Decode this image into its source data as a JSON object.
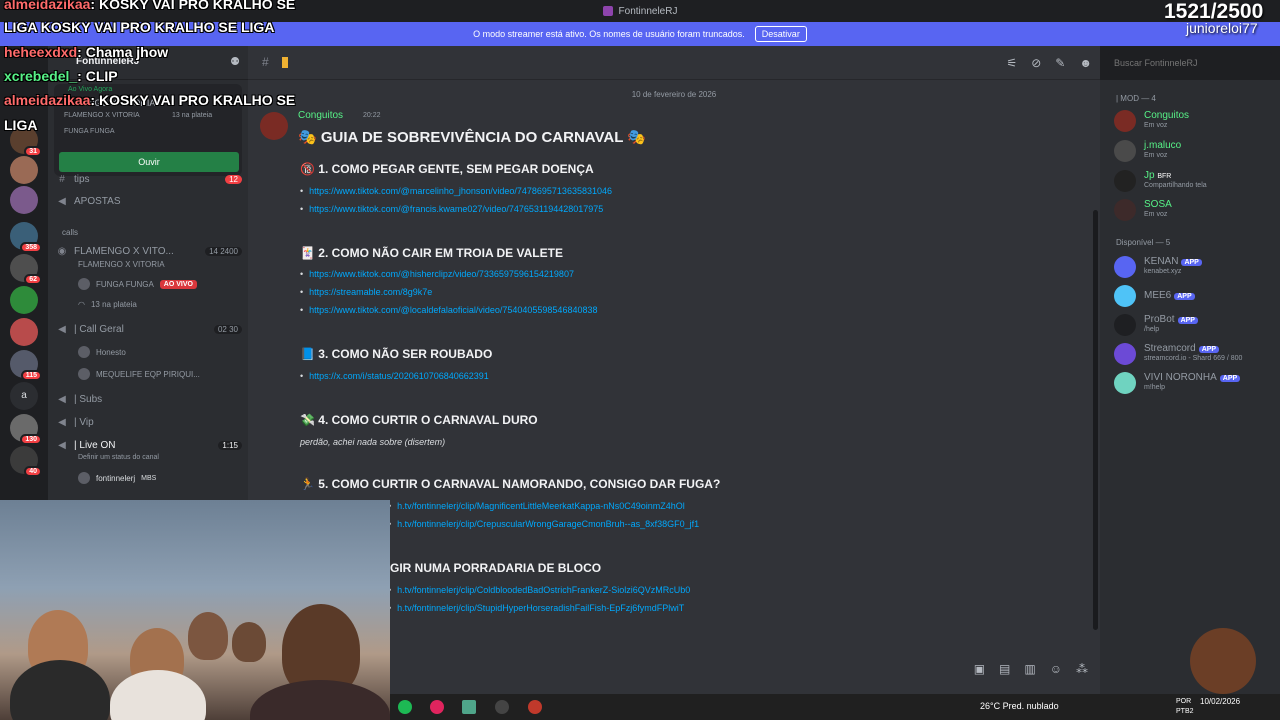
{
  "window": {
    "title": "FontinneleRJ"
  },
  "banner": {
    "text": "O modo streamer está ativo. Os nomes de usuário foram truncados.",
    "button": "Desativar"
  },
  "stream": {
    "counter": "1521/2500",
    "handle": "junioreloi77"
  },
  "chat_overlay": [
    {
      "user": "almeidazikaa",
      "text": "KOSKY VAI PRO KRALHO SE"
    },
    {
      "user": "",
      "text": "LIGA KOSKY VAI PRO KRALHO SE LIGA"
    },
    {
      "user": "heheexdxd",
      "text": "Chama jhow"
    },
    {
      "user": "xcrebedel_",
      "text": "CLIP"
    },
    {
      "user": "almeidazikaa",
      "text": "KOSKY VAI PRO KRALHO SE"
    },
    {
      "user": "",
      "text": "LIGA"
    }
  ],
  "sidebar": {
    "server_name": "FontinneleRJ",
    "event": {
      "live": "Ao Vivo Agora",
      "title": "FLAMENGO X VITORIA",
      "meta1": "FLAMENGO X VITORIA",
      "meta2": "13 na plateia",
      "host": "FUNGA FUNGA",
      "button": "Ouvir"
    },
    "channels": [
      {
        "name": "tips",
        "num": "12"
      },
      {
        "name": "APOSTAS",
        "num": ""
      },
      {
        "name": "calls",
        "num": ""
      },
      {
        "name": "FLAMENGO X VITO...",
        "num": "14  2400"
      },
      {
        "name": "FLAMENGO X VITORIA",
        "num": ""
      },
      {
        "name": "FUNGA FUNGA",
        "num": "AO VIVO"
      },
      {
        "name": "13 na plateia",
        "num": ""
      },
      {
        "name": "| Call Geral",
        "num": "02  30"
      },
      {
        "name": "Honesto",
        "num": ""
      },
      {
        "name": "MEQUELIFE EQP PIRIQUI...",
        "num": ""
      },
      {
        "name": "| Subs",
        "num": ""
      },
      {
        "name": "| Vip",
        "num": ""
      },
      {
        "name": "| Live ON",
        "num": "1:15"
      },
      {
        "name": "Definir um status do canal",
        "num": ""
      },
      {
        "name": "fontinnelerj",
        "num": "MBS"
      }
    ]
  },
  "rail_badges": [
    "31",
    "358",
    "62",
    "115",
    "130",
    "40",
    "a"
  ],
  "main": {
    "date": "10 de fevereiro de 2026",
    "author": "Conguitos",
    "time": "20:22",
    "title": "GUIA DE SOBREVIVÊNCIA DO CARNAVAL",
    "sections": [
      {
        "title": "1. COMO PEGAR GENTE, SEM PEGAR DOENÇA",
        "links": [
          "https://www.tiktok.com/@marcelinho_jhonson/video/7478695713635831046",
          "https://www.tiktok.com/@francis.kwame027/video/7476531194428017975"
        ]
      },
      {
        "title": "2. COMO NÃO CAIR EM TROIA DE VALETE",
        "links": [
          "https://www.tiktok.com/@hisherclipz/video/7336597596154219807",
          "https://streamable.com/8g9k7e",
          "https://www.tiktok.com/@localdefalaoficial/video/7540405598546840838"
        ]
      },
      {
        "title": "3. COMO NÃO SER ROUBADO",
        "links": [
          "https://x.com/i/status/2020610706840662391"
        ]
      },
      {
        "title": "4. COMO CURTIR O CARNAVAL DURO",
        "note": "perdão, achei nada sobre (disertem)"
      },
      {
        "title": "5. COMO CURTIR O CARNAVAL NAMORANDO, CONSIGO DAR FUGA?",
        "links": [
          "h.tv/fontinnelerj/clip/MagnificentLittleMeerkatKappa-nNs0C49oinmZ4hOl",
          "h.tv/fontinnelerj/clip/CrepuscularWrongGarageCmonBruh--as_8xf38GF0_jf1"
        ]
      },
      {
        "title": "GIR NUMA PORRADARIA DE BLOCO",
        "links": [
          "h.tv/fontinnelerj/clip/ColdbloodedBadOstrichFrankerZ-Siolzi6QVzMRcUb0",
          "h.tv/fontinnelerj/clip/StupidHyperHorseradishFailFish-EpFzj6fymdFPlwiT"
        ]
      }
    ]
  },
  "search": {
    "placeholder": "Buscar FontinneleRJ"
  },
  "members": {
    "group_mod": "| MOD — 4",
    "mods": [
      {
        "name": "Conguitos",
        "status": "Em voz",
        "color": "#57f287"
      },
      {
        "name": "j.maluco",
        "status": "Em voz",
        "color": "#57f287"
      },
      {
        "name": "Jp",
        "tag": "BFR",
        "status": "Compartilhando tela",
        "color": "#57f287"
      },
      {
        "name": "SOSA",
        "status": "Em voz",
        "color": "#57f287"
      }
    ],
    "group_avail": "Disponível — 5",
    "available": [
      {
        "name": "KENAN",
        "tag": "APP",
        "status": "kenabet.xyz"
      },
      {
        "name": "MEE6",
        "tag": "APP",
        "status": ""
      },
      {
        "name": "ProBot",
        "tag": "APP",
        "status": "/help"
      },
      {
        "name": "Streamcord",
        "tag": "APP",
        "status": "streamcord.io - Shard 669 / 800"
      },
      {
        "name": "VIVI NORONHA",
        "tag": "APP",
        "status": "m!help"
      }
    ]
  },
  "taskbar": {
    "weather": "26°C  Pred. nublado",
    "lang1": "POR",
    "lang2": "PTB2",
    "time": "",
    "date": "10/02/2026"
  }
}
